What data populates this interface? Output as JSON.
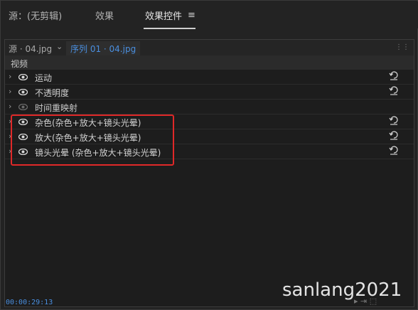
{
  "tabs": [
    {
      "label": "源：(无剪辑)"
    },
    {
      "label": "效果"
    },
    {
      "label": "效果控件"
    }
  ],
  "source_bar": {
    "source_label": "源 · 04.jpg",
    "sequence_label": "序列 01 · 04.jpg"
  },
  "section": {
    "label": "视频"
  },
  "effects": [
    {
      "name": "运动",
      "visible": true,
      "has_reset": true
    },
    {
      "name": "不透明度",
      "visible": true,
      "has_reset": true
    },
    {
      "name": "时间重映射",
      "visible": false,
      "has_reset": false
    },
    {
      "name": "杂色(杂色+放大+镜头光晕)",
      "visible": true,
      "has_reset": true
    },
    {
      "name": "放大(杂色+放大+镜头光晕)",
      "visible": true,
      "has_reset": true
    },
    {
      "name": "镜头光晕 (杂色+放大+镜头光晕)",
      "visible": true,
      "has_reset": true
    }
  ],
  "timecode": "00:00:29:13",
  "watermark": "sanlang2021",
  "colors": {
    "accent": "#4a8fe0",
    "highlight": "#e02828",
    "background": "#1d1d1d"
  },
  "icons": [
    "menu-icon",
    "chevron-down-icon",
    "expand-arrow-icon",
    "eye-icon",
    "reset-icon",
    "panel-grip-icon"
  ]
}
